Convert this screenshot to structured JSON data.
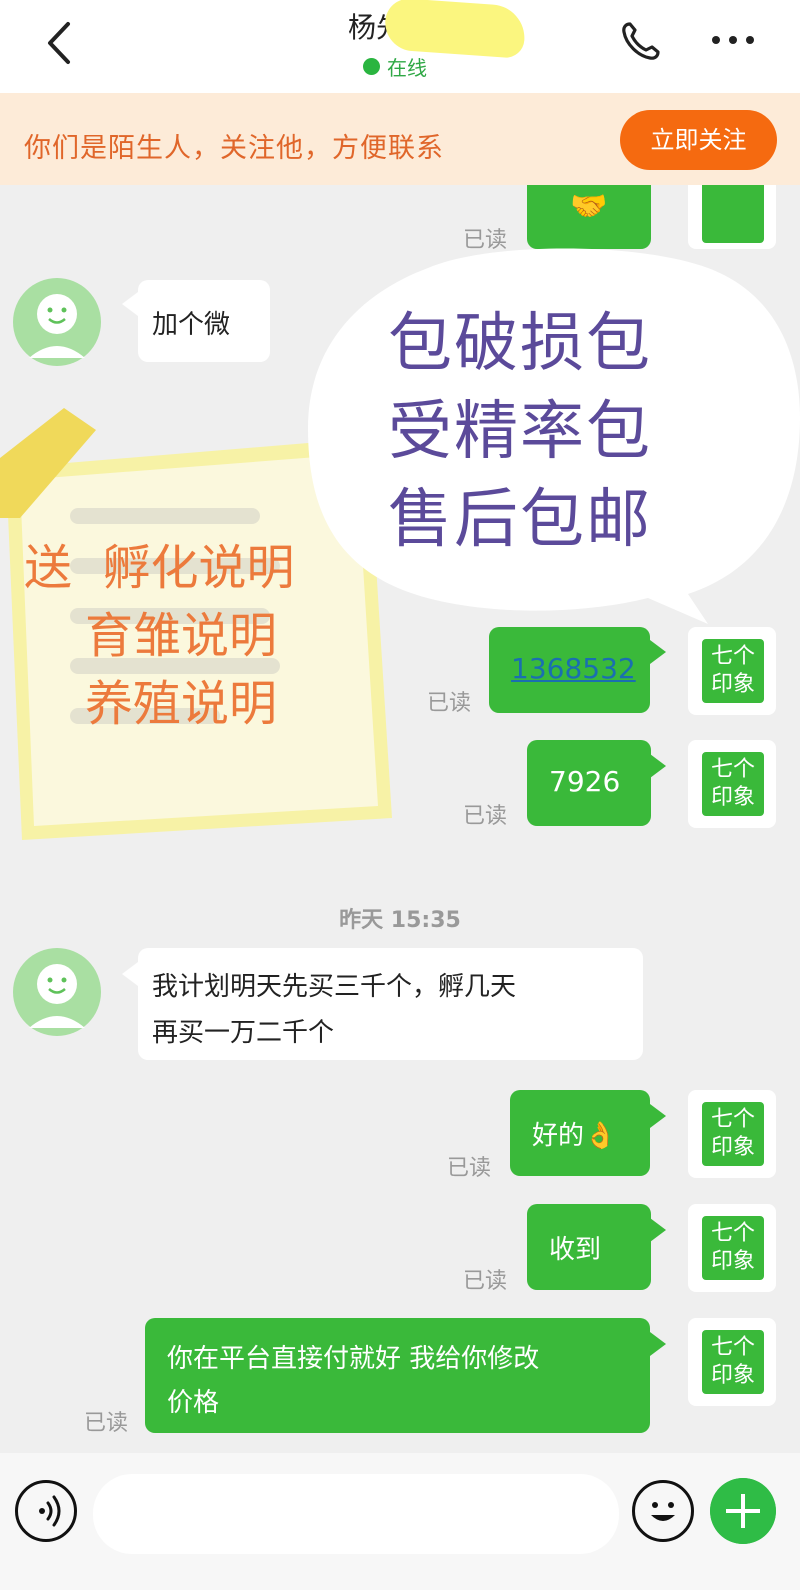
{
  "header": {
    "contact_name": "杨先",
    "status": "在线"
  },
  "banner": {
    "text": "你们是陌生人，关注他，方便联系",
    "button": "立即关注"
  },
  "messages": [
    {
      "side": "right",
      "content": "🤝",
      "status": "已读"
    },
    {
      "side": "left",
      "content": "加个微"
    },
    {
      "side": "right",
      "content": "1368532",
      "status": "已读"
    },
    {
      "side": "right",
      "content": "7926",
      "status": "已读"
    },
    {
      "side": "left",
      "content_lines": [
        "我计划明天先买三千个，孵几天",
        "再买一万二千个"
      ]
    },
    {
      "side": "right",
      "content": "好的👌",
      "status": "已读"
    },
    {
      "side": "right",
      "content": "收到",
      "status": "已读"
    },
    {
      "side": "right",
      "content_lines": [
        "你在平台直接付就好 我给你修改",
        "价格"
      ],
      "status": "已读"
    }
  ],
  "timestamp": "昨天 15:35",
  "avatar_right_text": [
    "七个",
    "印象"
  ],
  "overlay_cloud": {
    "lines": [
      "包破损包",
      "受精率包",
      "售后包邮"
    ]
  },
  "overlay_note": {
    "lines": [
      "送  孵化说明",
      "    育雏说明",
      "    养殖说明"
    ]
  },
  "colors": {
    "accent_green": "#3ab93a",
    "banner_bg": "#fdebd8",
    "banner_text": "#e0662a",
    "follow_button": "#f56a10",
    "cloud_text": "#5b4a9a",
    "note_text": "#ec7a3c"
  },
  "icons": {
    "back": "chevron-left-icon",
    "phone": "phone-icon",
    "more": "more-dots-icon",
    "voice": "voice-icon",
    "emoji": "emoji-icon",
    "plus": "plus-icon"
  }
}
